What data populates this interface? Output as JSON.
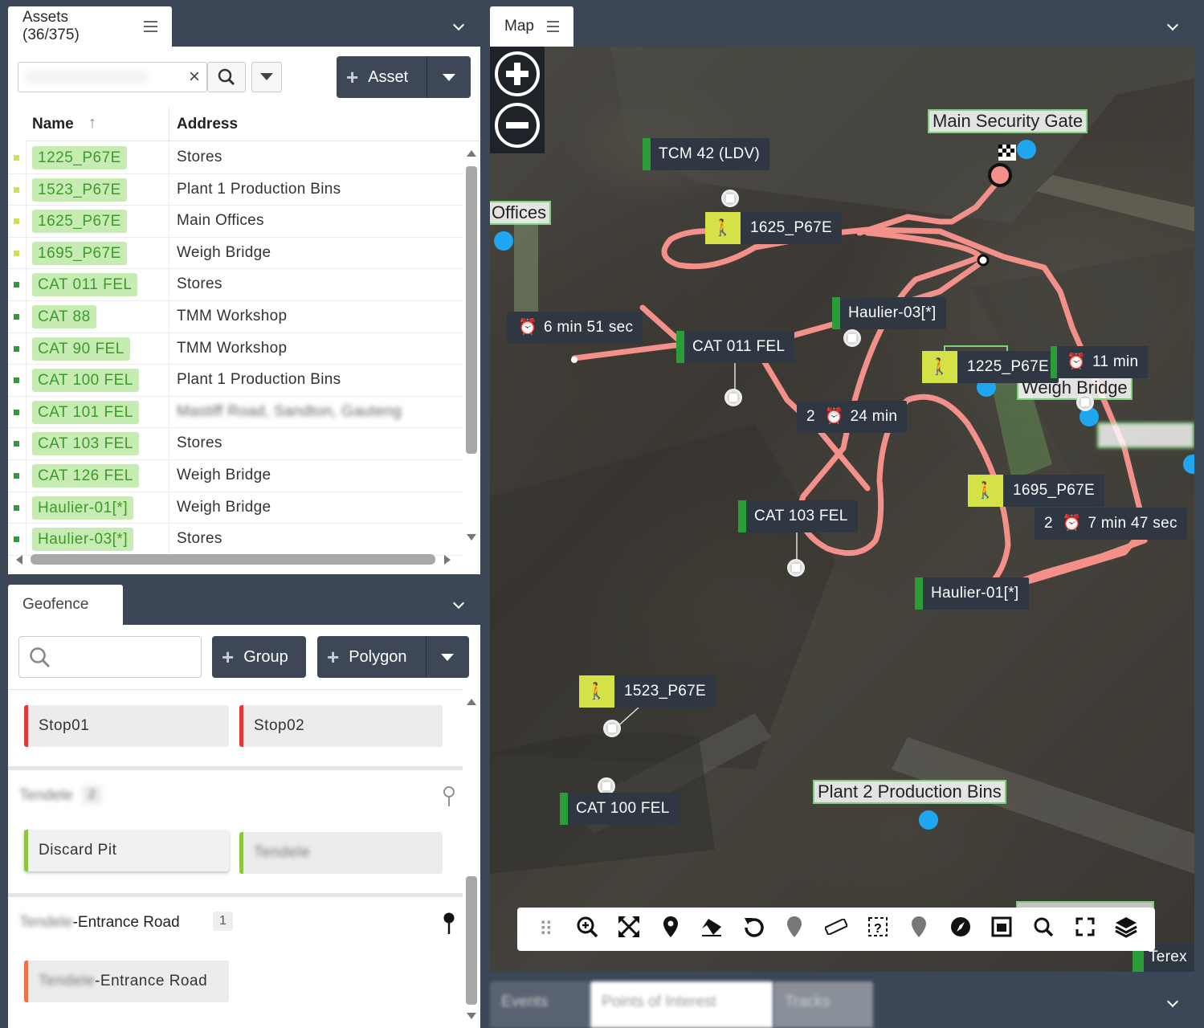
{
  "assets": {
    "tab_title": "Assets (36/375)",
    "search_value": "",
    "add_button_label": "Asset",
    "columns": {
      "name": "Name",
      "address": "Address"
    },
    "rows": [
      {
        "name": "1225_P67E",
        "address": "Stores",
        "status_color": "#d4e147"
      },
      {
        "name": "1523_P67E",
        "address": "Plant 1 Production Bins",
        "status_color": "#d4e147"
      },
      {
        "name": "1625_P67E",
        "address": "Main Offices",
        "status_color": "#d4e147"
      },
      {
        "name": "1695_P67E",
        "address": "Weigh Bridge",
        "status_color": "#d4e147"
      },
      {
        "name": "CAT 011 FEL",
        "address": "Stores",
        "status_color": "#2a9d39"
      },
      {
        "name": "CAT 88",
        "address": "TMM Workshop",
        "status_color": "#2a9d39"
      },
      {
        "name": "CAT 90 FEL",
        "address": "TMM Workshop",
        "status_color": "#2a9d39"
      },
      {
        "name": "CAT 100 FEL",
        "address": "Plant 1 Production Bins",
        "status_color": "#2a9d39"
      },
      {
        "name": "CAT 101 FEL",
        "address": "Mastiff Road, Sandton, Gauteng",
        "status_color": "#2a9d39"
      },
      {
        "name": "CAT 103 FEL",
        "address": "Stores",
        "status_color": "#2a9d39"
      },
      {
        "name": "CAT 126 FEL",
        "address": "Weigh Bridge",
        "status_color": "#2a9d39"
      },
      {
        "name": "Haulier-01[*]",
        "address": "Weigh Bridge",
        "status_color": "#2a9d39"
      },
      {
        "name": "Haulier-03[*]",
        "address": "Stores",
        "status_color": "#2a9d39"
      }
    ]
  },
  "geofence": {
    "tab_title": "Geofence",
    "search_value": "",
    "group_button_label": "Group",
    "polygon_button_label": "Polygon",
    "ungrouped": [
      {
        "label": "Stop01",
        "color": "#e03a3a"
      },
      {
        "label": "Stop02",
        "color": "#e03a3a"
      }
    ],
    "groups": [
      {
        "name": "Tendele",
        "count": "2",
        "items": [
          {
            "label": "Discard Pit",
            "color": "#8dc63f"
          },
          {
            "label": "Tendele",
            "color": "#8dc63f"
          }
        ]
      },
      {
        "name_prefix": "Tendele",
        "name_suffix": "-Entrance Road",
        "count": "1",
        "items": [
          {
            "label_prefix": "Tendele",
            "label_suffix": "-Entrance Road",
            "color": "#f07048"
          }
        ]
      }
    ]
  },
  "map": {
    "tab_title": "Map",
    "points_of_interest": [
      "Main Security Gate",
      "Offices",
      "Weigh Bridge",
      "Plant 2 Production Bins"
    ],
    "asset_labels": [
      {
        "text": "TCM 42 (LDV)",
        "kind": "vehicle"
      },
      {
        "text": "1625_P67E",
        "kind": "person"
      },
      {
        "text": "Haulier-03[*]",
        "kind": "vehicle"
      },
      {
        "text": "CAT 011 FEL",
        "kind": "vehicle"
      },
      {
        "text": "1225_P67E",
        "kind": "person"
      },
      {
        "text": "1695_P67E",
        "kind": "person"
      },
      {
        "text": "CAT 103 FEL",
        "kind": "vehicle"
      },
      {
        "text": "Haulier-01[*]",
        "kind": "vehicle"
      },
      {
        "text": "1523_P67E",
        "kind": "person"
      },
      {
        "text": "CAT 100 FEL",
        "kind": "vehicle"
      },
      {
        "text": "Terex",
        "kind": "vehicle"
      }
    ],
    "stop_timers": [
      {
        "count": "",
        "duration": "6 min 51 sec"
      },
      {
        "count": "",
        "duration": "11 min"
      },
      {
        "count": "2",
        "duration": "24 min"
      },
      {
        "count": "2",
        "duration": "7 min 47 sec"
      }
    ],
    "toolbar_icons": [
      "drag-handle-icon",
      "zoom-in-icon",
      "fit-bounds-icon",
      "pin-icon",
      "eraser-icon",
      "undo-icon",
      "marker-icon",
      "ruler-icon",
      "select-query-icon",
      "marker-icon",
      "compass-icon",
      "layout-icon",
      "search-icon",
      "fullscreen-icon",
      "layers-icon"
    ],
    "track_color": "#f4908a"
  },
  "bottom_tabs": [
    "Events",
    "Points of Interest",
    "Tracks"
  ]
}
